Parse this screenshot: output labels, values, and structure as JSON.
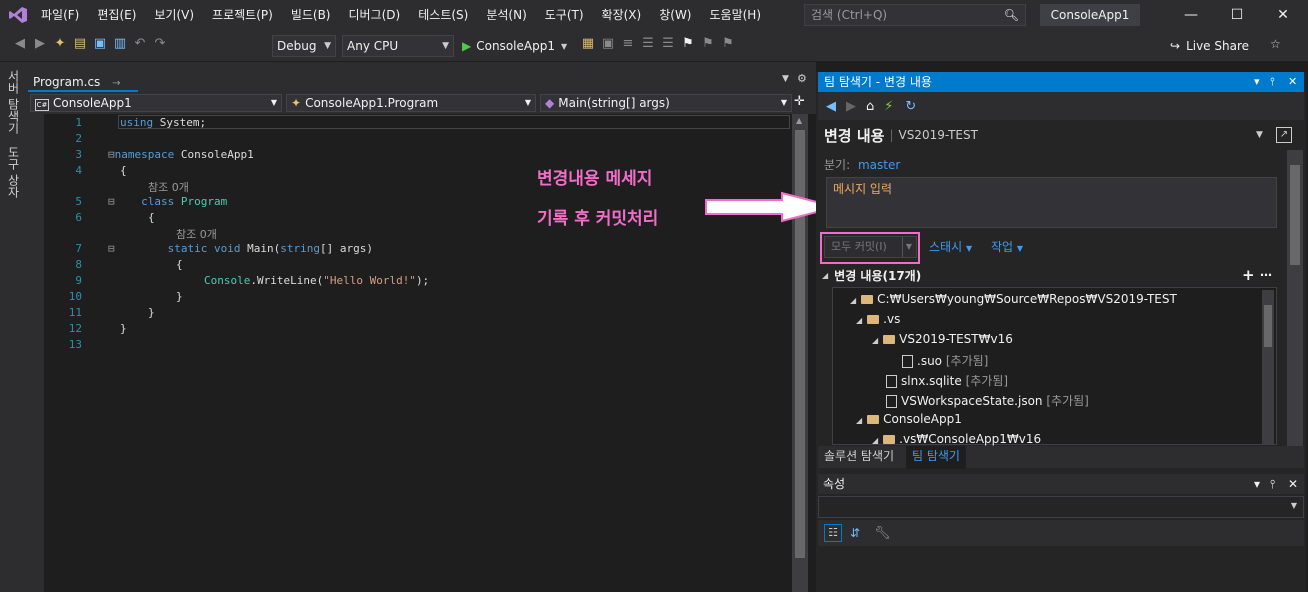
{
  "titlebar": {
    "menus": [
      "파일(F)",
      "편집(E)",
      "보기(V)",
      "프로젝트(P)",
      "빌드(B)",
      "디버그(D)",
      "테스트(S)",
      "분석(N)",
      "도구(T)",
      "확장(X)",
      "창(W)",
      "도움말(H)"
    ],
    "search_placeholder": "검색 (Ctrl+Q)",
    "app_name": "ConsoleApp1",
    "minimize": "—",
    "maximize": "☐",
    "close": "✕"
  },
  "toolbar": {
    "config": "Debug",
    "platform": "Any CPU",
    "run_target": "ConsoleApp1",
    "live_share": "Live Share"
  },
  "left_tabs": [
    "서버 탐색기",
    "도구 상자"
  ],
  "editor": {
    "tab_name": "Program.cs",
    "nav_project": "ConsoleApp1",
    "nav_class": "ConsoleApp1.Program",
    "nav_member": "Main(string[] args)",
    "line_numbers": [
      "1",
      "2",
      "3",
      "4",
      "",
      "5",
      "6",
      "",
      "7",
      "8",
      "9",
      "10",
      "11",
      "12",
      "13"
    ],
    "ref_label": "참조 0개"
  },
  "annotation": {
    "line1": "변경내용 메세지",
    "line2": "기록 후 커밋처리"
  },
  "team_explorer": {
    "title": "팀 탐색기 - 변경 내용",
    "heading": "변경 내용",
    "repo": "VS2019-TEST",
    "branch_label": "분기:",
    "branch": "master",
    "message_placeholder": "메시지 입력",
    "commit_button": "모두 커밋(I)",
    "stash": "스태시",
    "actions": "작업",
    "changes_header": "변경 내용(17개)",
    "tree": [
      {
        "text": "C:₩Users₩young₩Source₩Repos₩VS2019-TEST",
        "tag": ""
      },
      {
        "text": ".vs",
        "tag": ""
      },
      {
        "text": "VS2019-TEST₩v16",
        "tag": ""
      },
      {
        "text": ".suo",
        "tag": "[추가됨]"
      },
      {
        "text": "slnx.sqlite",
        "tag": "[추가됨]"
      },
      {
        "text": "VSWorkspaceState.json",
        "tag": "[추가됨]"
      },
      {
        "text": "ConsoleApp1",
        "tag": ""
      },
      {
        "text": ".vs₩ConsoleApp1₩v16",
        "tag": ""
      }
    ],
    "bottom_tabs": [
      "솔루션 탐색기",
      "팀 탐색기"
    ]
  },
  "properties": {
    "title": "속성"
  },
  "colors": {
    "accent": "#007acc",
    "annotation": "#f06ec8",
    "keyword": "#569cd6",
    "type": "#4ec9b0",
    "string": "#d69d85"
  }
}
